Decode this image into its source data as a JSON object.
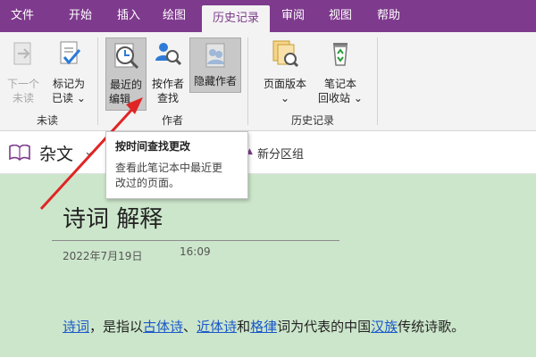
{
  "menu": {
    "tabs": [
      {
        "label": "文件",
        "active": false
      },
      {
        "label": "开始",
        "active": false
      },
      {
        "label": "插入",
        "active": false
      },
      {
        "label": "绘图",
        "active": false
      },
      {
        "label": "历史记录",
        "active": true
      },
      {
        "label": "审阅",
        "active": false
      },
      {
        "label": "视图",
        "active": false
      },
      {
        "label": "帮助",
        "active": false
      }
    ]
  },
  "ribbon": {
    "unread": {
      "group_label": "未读",
      "next_unread": {
        "line1": "下一个",
        "line2": "未读",
        "disabled": true
      },
      "mark_as_read": {
        "line1": "标记为",
        "line2": "已读",
        "dropdown": "⌄"
      }
    },
    "authors": {
      "group_label": "作者",
      "recent_edits": {
        "line1": "最近的",
        "line2": "编辑",
        "dropdown": "⌄"
      },
      "find_by_author": {
        "line1": "按作者",
        "line2": "查找"
      },
      "hide_authors": {
        "line1": "隐藏作者",
        "pressed": true
      }
    },
    "history": {
      "group_label": "历史记录",
      "page_versions": {
        "line1": "页面版本",
        "dropdown": "⌄"
      },
      "notebook_recycle_bin": {
        "line1": "笔记本",
        "line2": "回收站",
        "dropdown": "⌄"
      }
    }
  },
  "nav": {
    "notebook_name": "杂文",
    "new_section_group": "新分区组"
  },
  "tooltip": {
    "title": "按时间查找更改",
    "body_line1": "查看此笔记本中最近更",
    "body_line2": "改过的页面。"
  },
  "page": {
    "title": "诗词 解释",
    "date": "2022年7月19日",
    "time": "16:09",
    "body": {
      "link1": "诗词",
      "text1": "，是指以",
      "link2": "古体诗",
      "text2": "、",
      "link3": "近体诗",
      "text3": "和",
      "link4": "格律",
      "text4": "词为代表的中国",
      "link5": "汉族",
      "text5": "传统诗歌。"
    }
  },
  "colors": {
    "brand": "#7e3a8c",
    "page_bg": "#cce6cb",
    "ribbon_bg": "#f3f3f3",
    "arrow": "#e02525",
    "link": "#1a57c9"
  }
}
